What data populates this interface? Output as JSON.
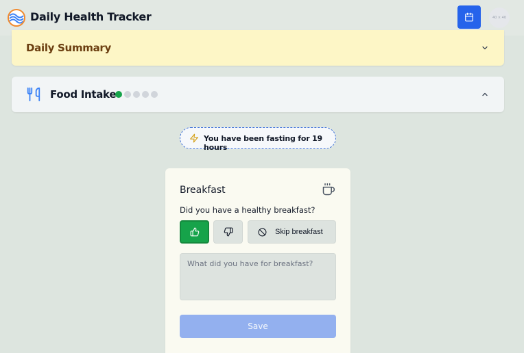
{
  "header": {
    "title": "Daily Health Tracker",
    "calendar_icon": "calendar-icon",
    "avatar_label": "40 × 40"
  },
  "sections": {
    "summary": {
      "title": "Daily Summary",
      "expanded": false
    },
    "food": {
      "title": "Food Intake",
      "expanded": true,
      "progress_steps_total": 5,
      "progress_steps_done": 1
    }
  },
  "fasting": {
    "text": "You have been fasting for 19 hours"
  },
  "meal": {
    "title": "Breakfast",
    "question": "Did you have a healthy breakfast?",
    "yes_selected": true,
    "skip_label": "Skip breakfast",
    "input_placeholder": "What did you have for breakfast?",
    "input_value": "",
    "save_label": "Save"
  },
  "colors": {
    "accent": "#2563eb",
    "success": "#16a34a",
    "summary_bg": "#fdf6c6",
    "summary_text": "#6b3e10",
    "save_disabled": "#93b0ef"
  }
}
